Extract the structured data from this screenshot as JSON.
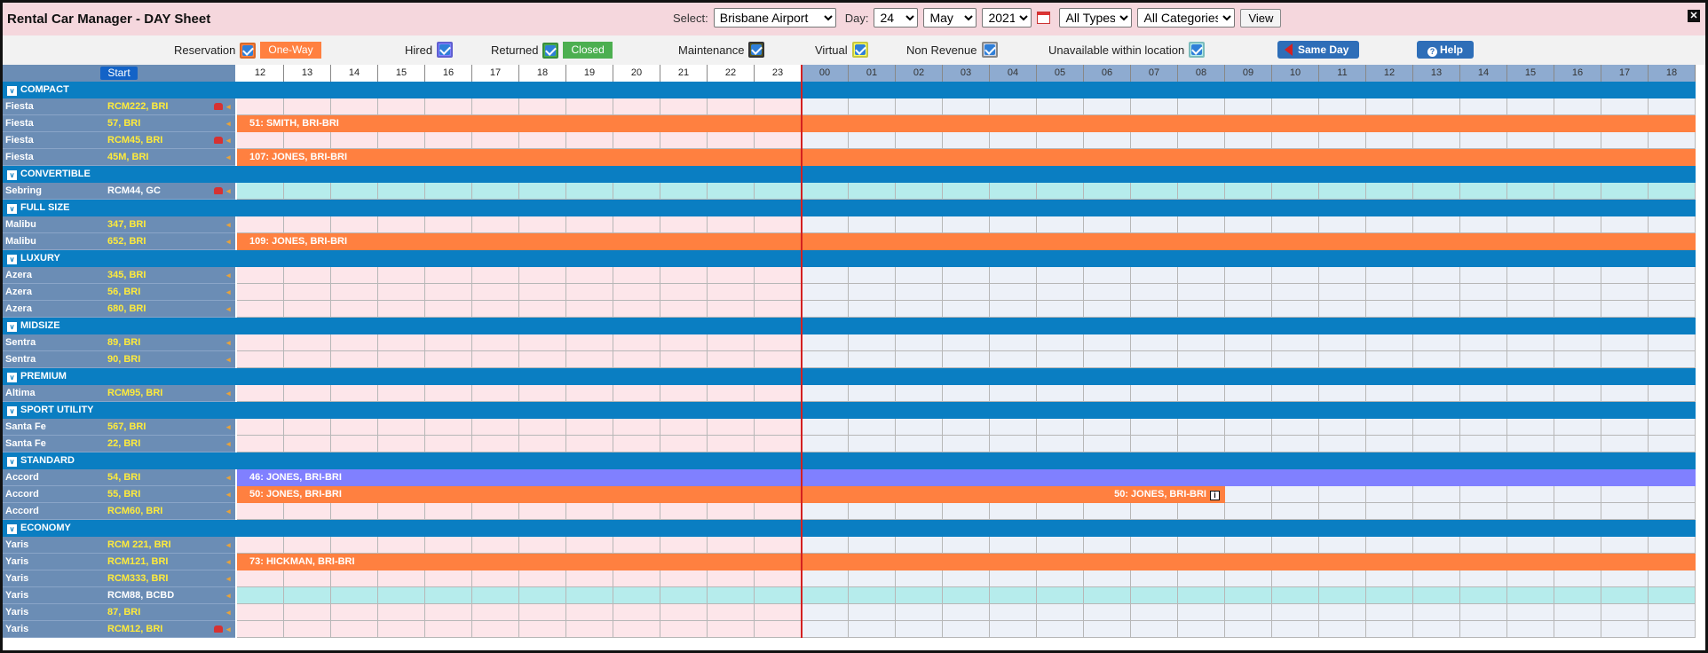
{
  "app": {
    "title": "Rental Car Manager - DAY Sheet"
  },
  "controls": {
    "select_label": "Select:",
    "location": "Brisbane Airport",
    "day_label": "Day:",
    "day": "24",
    "month": "May",
    "year": "2021",
    "types": "All Types",
    "categories": "All Categories",
    "view_label": "View"
  },
  "legend": {
    "reservation": "Reservation",
    "one_way": "One-Way",
    "hired": "Hired",
    "returned": "Returned",
    "closed": "Closed",
    "maintenance": "Maintenance",
    "virtual": "Virtual",
    "non_revenue": "Non Revenue",
    "unavailable": "Unavailable within location",
    "same_day": "Same Day",
    "help": "Help"
  },
  "colors": {
    "reservation": "#ff8040",
    "hired": "#8080ff",
    "closed": "#4caf50",
    "unavailable": "#b6ecec",
    "category": "#0a7ec2"
  },
  "grid": {
    "start_label": "Start",
    "hours": [
      "12",
      "13",
      "14",
      "15",
      "16",
      "17",
      "18",
      "19",
      "20",
      "21",
      "22",
      "23",
      "00",
      "01",
      "02",
      "03",
      "04",
      "05",
      "06",
      "07",
      "08",
      "09",
      "10",
      "11",
      "12",
      "13",
      "14",
      "15",
      "16",
      "17",
      "18"
    ],
    "rows": [
      {
        "type": "cat",
        "label": "COMPACT"
      },
      {
        "type": "car",
        "model": "Fiesta",
        "plate": "RCM222, BRI",
        "icon": true
      },
      {
        "type": "car",
        "model": "Fiesta",
        "plate": "57, BRI",
        "bar": {
          "text": "51: SMITH, BRI-BRI",
          "kind": "reservation",
          "from": 0,
          "to": 31
        }
      },
      {
        "type": "car",
        "model": "Fiesta",
        "plate": "RCM45, BRI",
        "icon": true
      },
      {
        "type": "car",
        "model": "Fiesta",
        "plate": "45M, BRI",
        "bar": {
          "text": "107: JONES, BRI-BRI",
          "kind": "reservation",
          "from": 0,
          "to": 31
        }
      },
      {
        "type": "cat",
        "label": "CONVERTIBLE"
      },
      {
        "type": "car",
        "model": "Sebring",
        "plate": "RCM44, GC",
        "white": true,
        "icon": true,
        "unavailable": true
      },
      {
        "type": "cat",
        "label": "FULL SIZE"
      },
      {
        "type": "car",
        "model": "Malibu",
        "plate": "347, BRI"
      },
      {
        "type": "car",
        "model": "Malibu",
        "plate": "652, BRI",
        "bar": {
          "text": "109: JONES, BRI-BRI",
          "kind": "reservation",
          "from": 0,
          "to": 31
        }
      },
      {
        "type": "cat",
        "label": "LUXURY"
      },
      {
        "type": "car",
        "model": "Azera",
        "plate": "345, BRI"
      },
      {
        "type": "car",
        "model": "Azera",
        "plate": "56, BRI"
      },
      {
        "type": "car",
        "model": "Azera",
        "plate": "680, BRI"
      },
      {
        "type": "cat",
        "label": "MIDSIZE"
      },
      {
        "type": "car",
        "model": "Sentra",
        "plate": "89, BRI"
      },
      {
        "type": "car",
        "model": "Sentra",
        "plate": "90, BRI"
      },
      {
        "type": "cat",
        "label": "PREMIUM"
      },
      {
        "type": "car",
        "model": "Altima",
        "plate": "RCM95, BRI"
      },
      {
        "type": "cat",
        "label": "SPORT UTILITY"
      },
      {
        "type": "car",
        "model": "Santa Fe",
        "plate": "567, BRI"
      },
      {
        "type": "car",
        "model": "Santa Fe",
        "plate": "22, BRI"
      },
      {
        "type": "cat",
        "label": "STANDARD"
      },
      {
        "type": "car",
        "model": "Accord",
        "plate": "54, BRI",
        "bar": {
          "text": "46: JONES, BRI-BRI",
          "kind": "hired",
          "from": 0,
          "to": 31
        }
      },
      {
        "type": "car",
        "model": "Accord",
        "plate": "55, BRI",
        "bar": {
          "text": "50: JONES, BRI-BRI",
          "kind": "reservation",
          "from": 0,
          "to": 21
        },
        "bar_end_text": "50: JONES, BRI-BRI",
        "bar_end_icon": "i"
      },
      {
        "type": "car",
        "model": "Accord",
        "plate": "RCM60, BRI"
      },
      {
        "type": "cat",
        "label": "ECONOMY"
      },
      {
        "type": "car",
        "model": "Yaris",
        "plate": "RCM 221, BRI"
      },
      {
        "type": "car",
        "model": "Yaris",
        "plate": "RCM121, BRI",
        "bar": {
          "text": "73: HICKMAN, BRI-BRI",
          "kind": "reservation",
          "from": 0,
          "to": 31
        }
      },
      {
        "type": "car",
        "model": "Yaris",
        "plate": "RCM333, BRI"
      },
      {
        "type": "car",
        "model": "Yaris",
        "plate": "RCM88, BCBD",
        "white": true,
        "unavailable": true
      },
      {
        "type": "car",
        "model": "Yaris",
        "plate": "87, BRI"
      },
      {
        "type": "car",
        "model": "Yaris",
        "plate": "RCM12, BRI",
        "icon": true
      }
    ]
  }
}
